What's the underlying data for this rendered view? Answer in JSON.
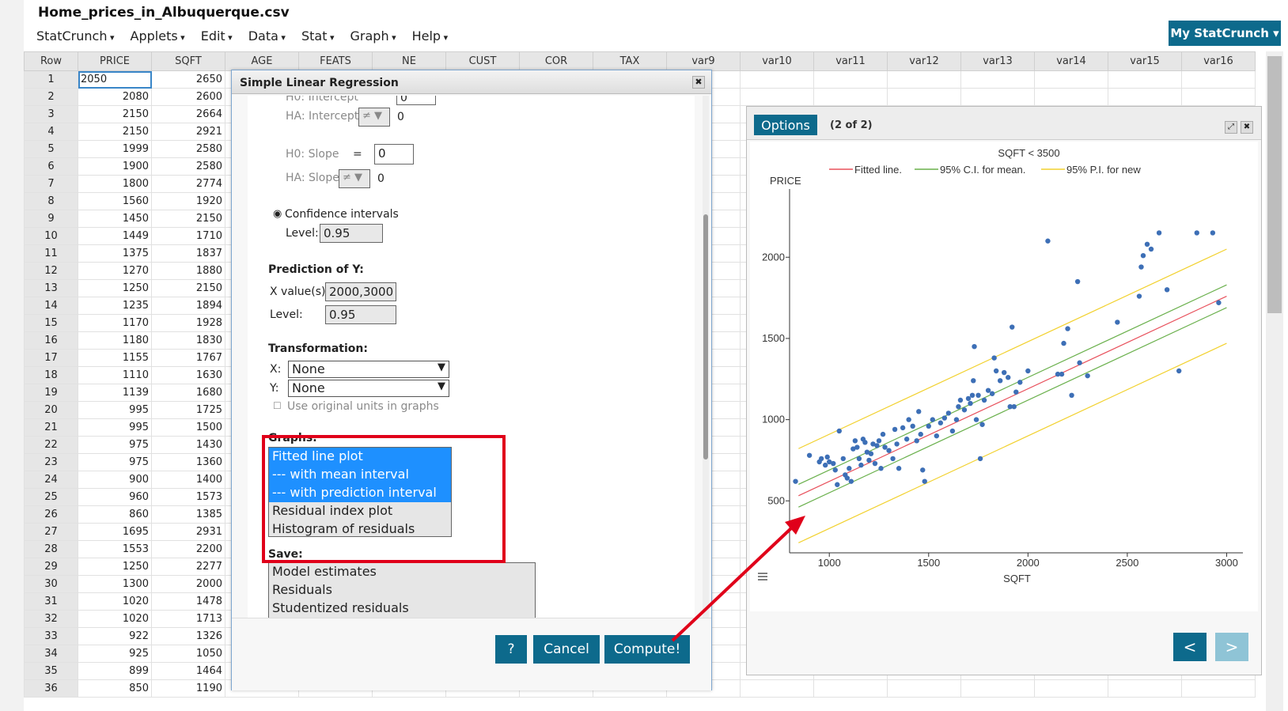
{
  "app": {
    "file_title": "Home_prices_in_Albuquerque.csv",
    "menu": [
      "StatCrunch",
      "Applets",
      "Edit",
      "Data",
      "Stat",
      "Graph",
      "Help"
    ],
    "account_button": "My StatCrunch"
  },
  "sheet": {
    "columns": [
      "Row",
      "PRICE",
      "SQFT",
      "AGE",
      "FEATS",
      "NE",
      "CUST",
      "COR",
      "TAX",
      "var9",
      "var10",
      "var11",
      "var12",
      "var13",
      "var14",
      "var15",
      "var16"
    ],
    "rows": [
      [
        "1",
        "2050",
        "2650"
      ],
      [
        "2",
        "2080",
        "2600"
      ],
      [
        "3",
        "2150",
        "2664"
      ],
      [
        "4",
        "2150",
        "2921"
      ],
      [
        "5",
        "1999",
        "2580"
      ],
      [
        "6",
        "1900",
        "2580"
      ],
      [
        "7",
        "1800",
        "2774"
      ],
      [
        "8",
        "1560",
        "1920"
      ],
      [
        "9",
        "1450",
        "2150"
      ],
      [
        "10",
        "1449",
        "1710"
      ],
      [
        "11",
        "1375",
        "1837"
      ],
      [
        "12",
        "1270",
        "1880"
      ],
      [
        "13",
        "1250",
        "2150"
      ],
      [
        "14",
        "1235",
        "1894"
      ],
      [
        "15",
        "1170",
        "1928"
      ],
      [
        "16",
        "1180",
        "1830"
      ],
      [
        "17",
        "1155",
        "1767"
      ],
      [
        "18",
        "1110",
        "1630"
      ],
      [
        "19",
        "1139",
        "1680"
      ],
      [
        "20",
        "995",
        "1725"
      ],
      [
        "21",
        "995",
        "1500"
      ],
      [
        "22",
        "975",
        "1430"
      ],
      [
        "23",
        "975",
        "1360"
      ],
      [
        "24",
        "900",
        "1400"
      ],
      [
        "25",
        "960",
        "1573"
      ],
      [
        "26",
        "860",
        "1385"
      ],
      [
        "27",
        "1695",
        "2931"
      ],
      [
        "28",
        "1553",
        "2200"
      ],
      [
        "29",
        "1250",
        "2277"
      ],
      [
        "30",
        "1300",
        "2000"
      ],
      [
        "31",
        "1020",
        "1478"
      ],
      [
        "32",
        "1020",
        "1713"
      ],
      [
        "33",
        "922",
        "1326"
      ],
      [
        "34",
        "925",
        "1050"
      ],
      [
        "35",
        "899",
        "1464"
      ],
      [
        "36",
        "850",
        "1190"
      ]
    ]
  },
  "dialog": {
    "title": "Simple Linear Regression",
    "h0_intercept_label": "H0: Intercept",
    "h0_intercept_value": "0",
    "ha_intercept_label": "HA: Intercept",
    "ha_intercept_op": "≠",
    "ha_intercept_value": "0",
    "h0_slope_label": "H0: Slope",
    "h0_slope_eq": "=",
    "h0_slope_value": "0",
    "ha_slope_label": "HA: Slope",
    "ha_slope_op": "≠",
    "ha_slope_value": "0",
    "ci_label": "Confidence intervals",
    "level_label": "Level:",
    "ci_level": "0.95",
    "pred_title": "Prediction of Y:",
    "xvalues_label": "X value(s):",
    "xvalues": "2000,3000",
    "pred_level_label": "Level:",
    "pred_level": "0.95",
    "trans_title": "Transformation:",
    "x_label": "X:",
    "x_trans": "None",
    "y_label": "Y:",
    "y_trans": "None",
    "orig_units_label": "Use original units in graphs",
    "graphs_title": "Graphs:",
    "graphs_options": [
      "Fitted line plot",
      "--- with mean interval",
      "--- with prediction interval",
      "Residual index plot",
      "Histogram of residuals"
    ],
    "save_title": "Save:",
    "save_options": [
      "Model estimates",
      "Residuals",
      "Studentized residuals"
    ],
    "help_button": "?",
    "cancel_button": "Cancel",
    "compute_button": "Compute!"
  },
  "graph_window": {
    "options_button": "Options",
    "page_label": "(2 of 2)",
    "prev_button": "<",
    "next_button": ">"
  },
  "chart_data": {
    "type": "scatter",
    "title": "SQFT < 3500",
    "xlabel": "SQFT",
    "ylabel": "PRICE",
    "xlim": [
      800,
      3050
    ],
    "ylim": [
      180,
      2420
    ],
    "xticks": [
      1000,
      1500,
      2000,
      2500,
      3000
    ],
    "yticks": [
      500,
      1000,
      1500,
      2000
    ],
    "legend": [
      "Fitted line.",
      "95% C.I. for mean.",
      "95% P.I. for new"
    ],
    "legend_colors": [
      "#e8505b",
      "#6ab04c",
      "#f2d12e"
    ],
    "point_color": "#3d6fb6",
    "fit": {
      "intercept": 50,
      "slope": 0.57
    },
    "ci_halfwidth": 70,
    "pi_halfwidth": 290,
    "points": [
      [
        830,
        620
      ],
      [
        900,
        780
      ],
      [
        950,
        740
      ],
      [
        960,
        760
      ],
      [
        980,
        720
      ],
      [
        990,
        770
      ],
      [
        1000,
        740
      ],
      [
        1020,
        730
      ],
      [
        1030,
        690
      ],
      [
        1040,
        600
      ],
      [
        1050,
        930
      ],
      [
        1070,
        760
      ],
      [
        1080,
        660
      ],
      [
        1090,
        640
      ],
      [
        1100,
        700
      ],
      [
        1110,
        620
      ],
      [
        1120,
        820
      ],
      [
        1130,
        870
      ],
      [
        1140,
        830
      ],
      [
        1150,
        760
      ],
      [
        1160,
        720
      ],
      [
        1170,
        880
      ],
      [
        1180,
        860
      ],
      [
        1190,
        800
      ],
      [
        1200,
        750
      ],
      [
        1210,
        790
      ],
      [
        1220,
        850
      ],
      [
        1230,
        730
      ],
      [
        1240,
        840
      ],
      [
        1250,
        870
      ],
      [
        1260,
        700
      ],
      [
        1270,
        910
      ],
      [
        1280,
        830
      ],
      [
        1300,
        810
      ],
      [
        1320,
        760
      ],
      [
        1330,
        940
      ],
      [
        1340,
        850
      ],
      [
        1350,
        700
      ],
      [
        1370,
        950
      ],
      [
        1390,
        880
      ],
      [
        1400,
        1000
      ],
      [
        1420,
        960
      ],
      [
        1440,
        870
      ],
      [
        1450,
        1050
      ],
      [
        1460,
        910
      ],
      [
        1470,
        690
      ],
      [
        1480,
        620
      ],
      [
        1500,
        960
      ],
      [
        1520,
        1000
      ],
      [
        1540,
        900
      ],
      [
        1560,
        980
      ],
      [
        1580,
        1010
      ],
      [
        1600,
        1040
      ],
      [
        1620,
        930
      ],
      [
        1640,
        1000
      ],
      [
        1650,
        1080
      ],
      [
        1660,
        1120
      ],
      [
        1680,
        1060
      ],
      [
        1700,
        1130
      ],
      [
        1710,
        1100
      ],
      [
        1720,
        1150
      ],
      [
        1725,
        1240
      ],
      [
        1730,
        1450
      ],
      [
        1740,
        1000
      ],
      [
        1750,
        1150
      ],
      [
        1760,
        760
      ],
      [
        1770,
        970
      ],
      [
        1780,
        1120
      ],
      [
        1800,
        1180
      ],
      [
        1820,
        1160
      ],
      [
        1830,
        1380
      ],
      [
        1840,
        1300
      ],
      [
        1860,
        1240
      ],
      [
        1880,
        1290
      ],
      [
        1900,
        1260
      ],
      [
        1910,
        1080
      ],
      [
        1920,
        1570
      ],
      [
        1930,
        1080
      ],
      [
        1940,
        1170
      ],
      [
        1960,
        1230
      ],
      [
        2000,
        1300
      ],
      [
        2100,
        2100
      ],
      [
        2150,
        1280
      ],
      [
        2170,
        1280
      ],
      [
        2180,
        1470
      ],
      [
        2200,
        1560
      ],
      [
        2220,
        1150
      ],
      [
        2250,
        1850
      ],
      [
        2260,
        1350
      ],
      [
        2300,
        1270
      ],
      [
        2450,
        1600
      ],
      [
        2560,
        1760
      ],
      [
        2570,
        1940
      ],
      [
        2580,
        2010
      ],
      [
        2600,
        2080
      ],
      [
        2620,
        2050
      ],
      [
        2660,
        2150
      ],
      [
        2700,
        1800
      ],
      [
        2760,
        1300
      ],
      [
        2850,
        2150
      ],
      [
        2930,
        2150
      ],
      [
        2960,
        1720
      ]
    ]
  }
}
